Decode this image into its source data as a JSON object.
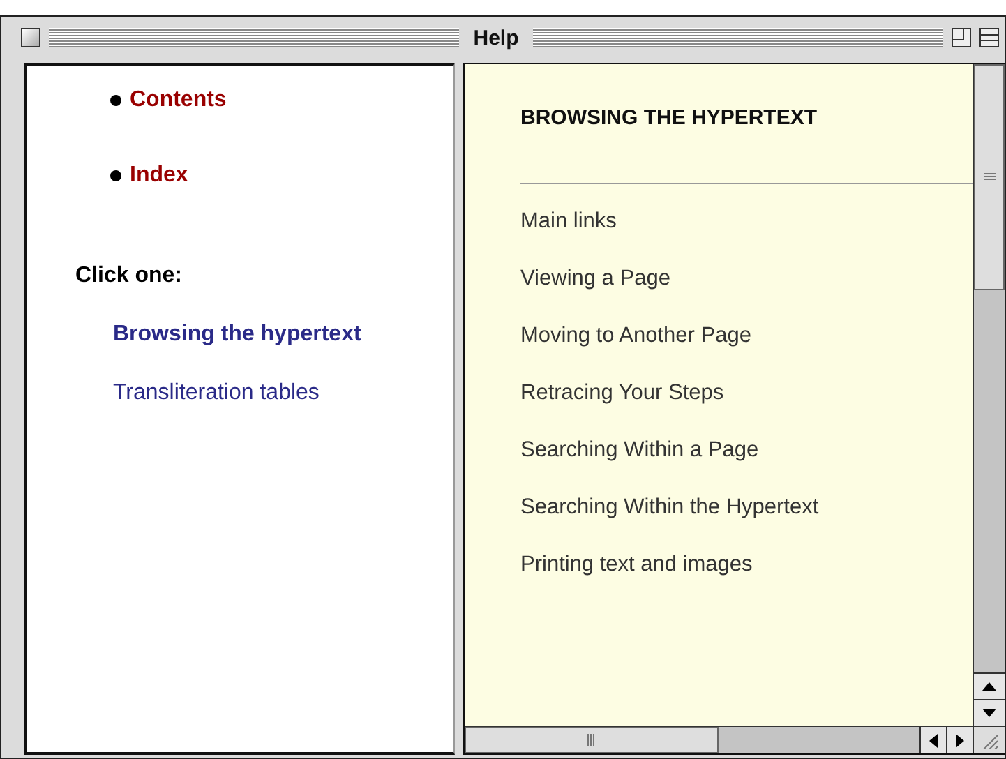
{
  "window": {
    "title": "Help"
  },
  "nav": {
    "links": [
      "Contents",
      "Index"
    ],
    "prompt": "Click one:",
    "topics": [
      {
        "label": "Browsing the hypertext",
        "selected": true
      },
      {
        "label": "Transliteration tables",
        "selected": false
      }
    ]
  },
  "content": {
    "heading": "BROWSING THE HYPERTEXT",
    "items": [
      "Main links",
      "Viewing a Page",
      "Moving to Another Page",
      "Retracing Your Steps",
      "Searching Within a Page",
      "Searching Within the Hypertext",
      "Printing text and images"
    ]
  }
}
